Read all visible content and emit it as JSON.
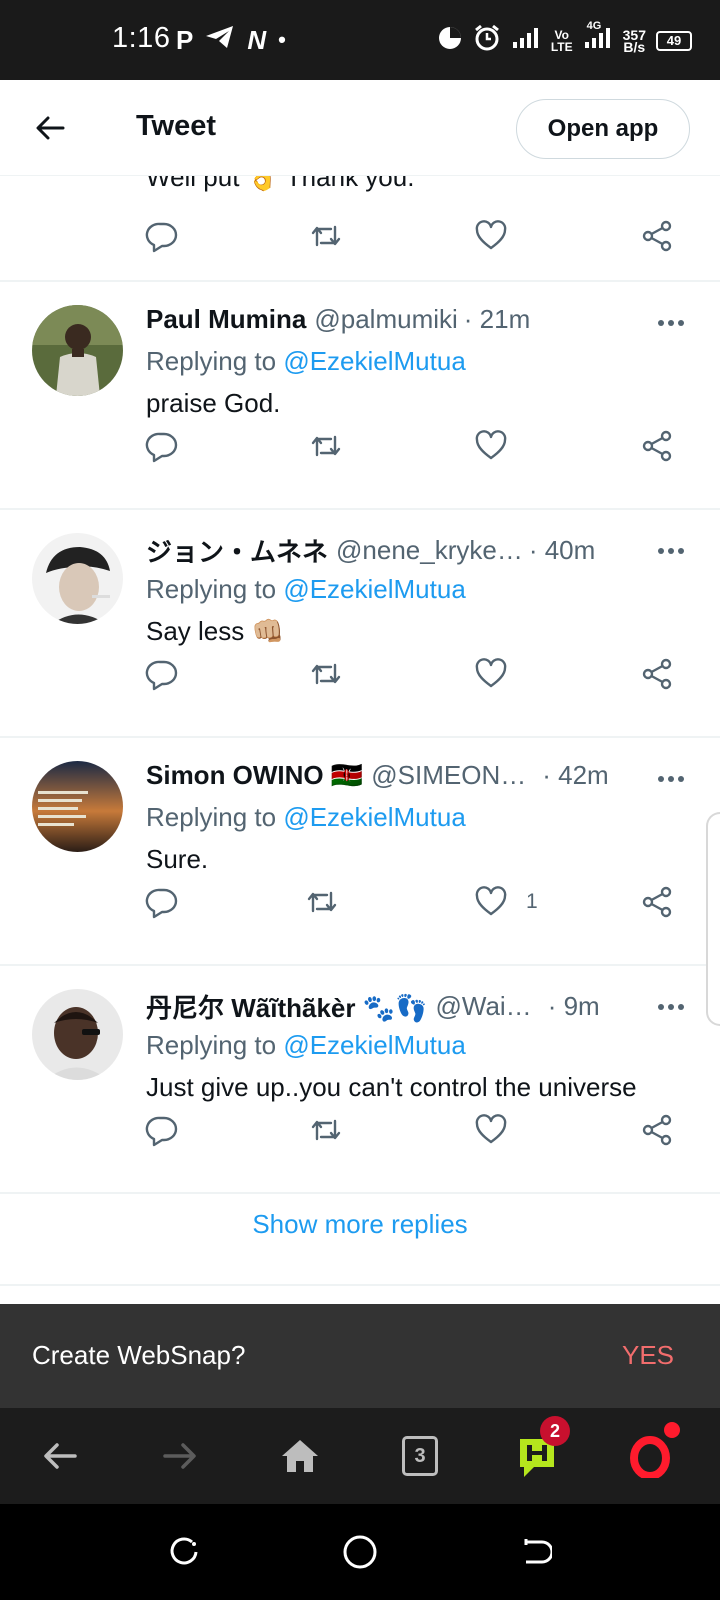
{
  "status_bar": {
    "time": "1:16",
    "left_icons": [
      "P",
      "telegram-icon",
      "N",
      "•"
    ],
    "network": {
      "vo": "Vo",
      "lte": "LTE",
      "g": "4G",
      "speed_value": "357",
      "speed_unit": "B/s"
    },
    "battery": "49"
  },
  "header": {
    "title": "Tweet",
    "open_app_label": "Open app"
  },
  "partial_tweet": {
    "text": "Well put 👌 Thank you."
  },
  "tweets": [
    {
      "name": "Paul Mumina",
      "handle": "@palmumiki",
      "time": "· 21m",
      "replying_prefix": "Replying to ",
      "mention": "@EzekielMutua",
      "text": "praise God.",
      "likes": ""
    },
    {
      "name": "ジョン・ムネネ",
      "handle": "@nene_kryke…",
      "time": "· 40m",
      "replying_prefix": "Replying to ",
      "mention": "@EzekielMutua",
      "text": "Say less 👊🏼",
      "likes": ""
    },
    {
      "name": "Simon OWINO 🇰🇪",
      "handle": "@SIMEON…",
      "time": "· 42m",
      "replying_prefix": "Replying to ",
      "mention": "@EzekielMutua",
      "text": "Sure.",
      "likes": "1"
    },
    {
      "name": "丹尼尔 Wãĩthãkèr 🐾👣",
      "handle": "@Wai…",
      "time": "· 9m",
      "replying_prefix": "Replying to ",
      "mention": "@EzekielMutua",
      "text": "Just give up..you can't control the universe",
      "likes": ""
    }
  ],
  "show_more_label": "Show more replies",
  "websnap": {
    "prompt": "Create WebSnap?",
    "yes_label": "YES"
  },
  "browser_bar": {
    "tab_count": "3",
    "notification_count": "2"
  },
  "colors": {
    "accent": "#1d9bf0",
    "secondary_text": "#536471",
    "websnap_yes": "#f26d6d",
    "badge": "#c8102e",
    "opera": "#ff1b2d"
  }
}
